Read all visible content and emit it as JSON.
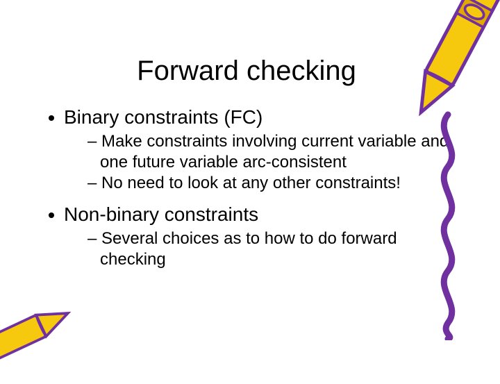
{
  "slide": {
    "title": "Forward checking",
    "bullets": [
      {
        "text": "Binary constraints (FC)",
        "children": [
          "Make constraints involving current variable and one future variable arc-consistent",
          "No need to look at any other constraints!"
        ]
      },
      {
        "text": "Non-binary constraints",
        "children": [
          "Several choices as to how to do forward checking"
        ]
      }
    ]
  },
  "decor": {
    "crayon_color_body": "#f6c90e",
    "crayon_color_label": "#e0a800",
    "crayon_outline": "#7030a0",
    "squiggle_color": "#7030a0"
  }
}
